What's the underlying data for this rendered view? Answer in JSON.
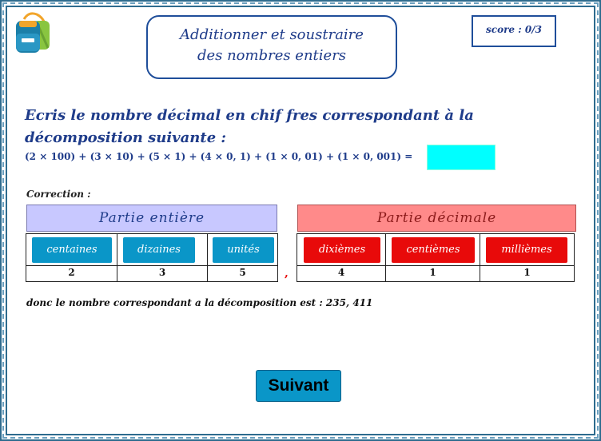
{
  "header": {
    "title_line1": "Additionner et soustraire",
    "title_line2": "des nombres entiers",
    "score": "score : 0/3"
  },
  "question": {
    "line1": "Ecris le nombre décimal en chif fres correspondant à la",
    "line2": "décomposition suivante :",
    "equation": "(2 × 100) + (3 × 10) + (5 × 1) + (4 × 0, 1) + (1 × 0, 01) + (1 × 0, 001) =",
    "answer_value": ""
  },
  "correction": {
    "label": "Correction :",
    "partie_entiere": "Partie entière",
    "partie_decimale": "Partie décimale",
    "columns": [
      "centaines",
      "dizaines",
      "unités",
      "dixièmes",
      "centièmes",
      "millièmes"
    ],
    "digits": [
      "2",
      "3",
      "5",
      "4",
      "1",
      "1"
    ],
    "comma": ",",
    "conclusion": "donc le nombre correspondant a la décomposition est : 235, 411"
  },
  "footer": {
    "next_label": "Suivant"
  },
  "colors": {
    "title_blue": "#1f3c8a",
    "input_cyan": "#00ffff",
    "entiere_bg": "#c8c8ff",
    "decimale_bg": "#ff8a8a",
    "blue_button": "#0a96c8",
    "red_button": "#e80a0a"
  },
  "icons": {
    "logo": "backpack-icon"
  }
}
